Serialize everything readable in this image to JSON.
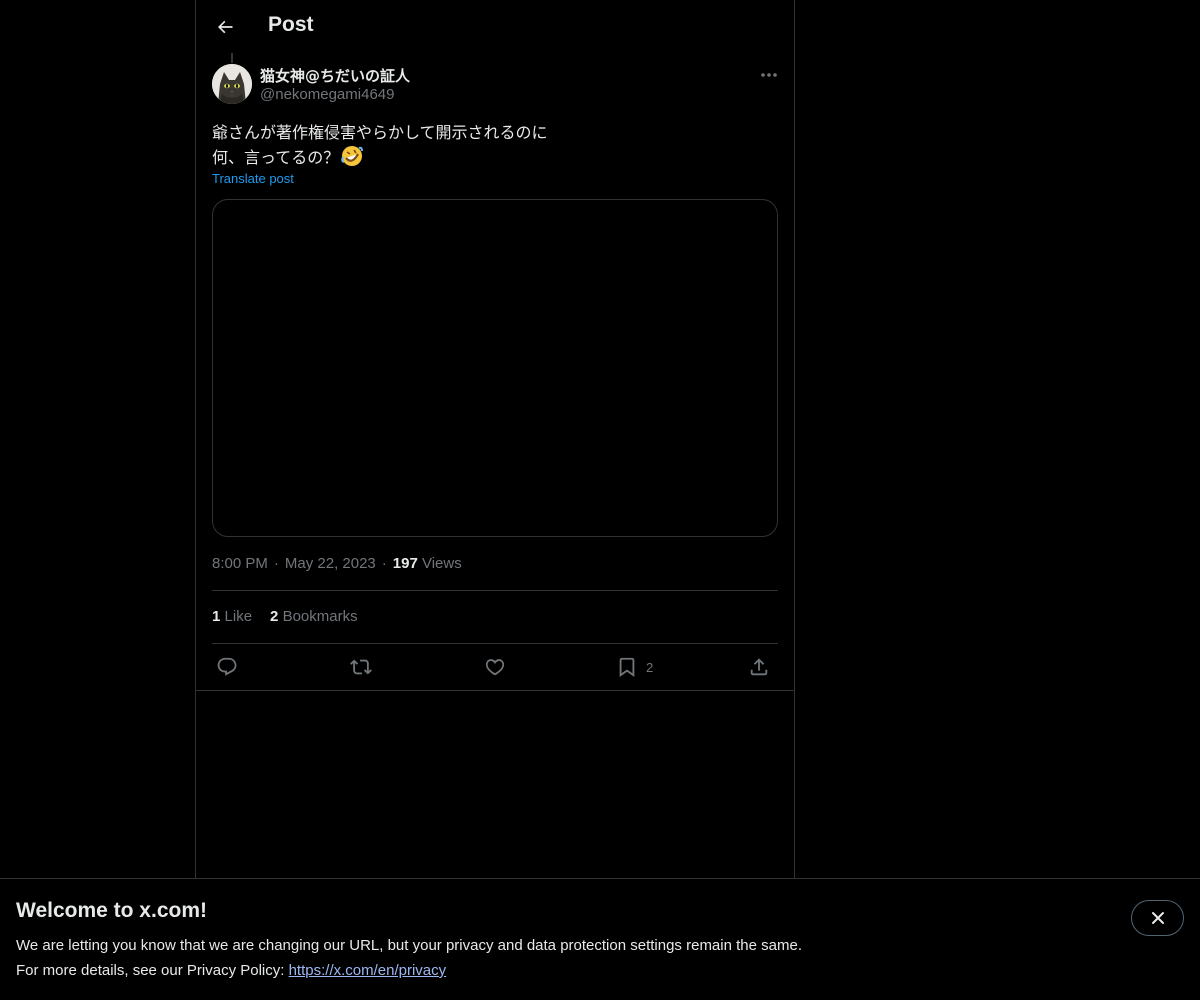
{
  "header": {
    "title": "Post",
    "back_icon": "arrow-left-icon"
  },
  "post": {
    "author": {
      "name": "猫女神@ちだいの証人",
      "handle": "@nekomegami4649",
      "avatar": "cat-avatar"
    },
    "text_lines": [
      "爺さんが著作権侵害やらかして開示されるのに",
      "何、言ってるの？"
    ],
    "emoji": "rolling-on-floor-laughing-emoji",
    "translate_label": "Translate post",
    "time": "8:00 PM",
    "separator": "·",
    "date": "May 22, 2023",
    "views_count": "197",
    "views_label": "Views",
    "likes_count": "1",
    "likes_label": "Like",
    "bookmarks_count": "2",
    "bookmarks_label": "Bookmarks",
    "actions": {
      "reply_icon": "reply-icon",
      "repost_icon": "repost-icon",
      "like_icon": "heart-icon",
      "bookmark_icon": "bookmark-icon",
      "bookmark_count": "2",
      "share_icon": "share-icon"
    }
  },
  "banner": {
    "title": "Welcome to x.com!",
    "line1": "We are letting you know that we are changing our URL, but your privacy and data protection settings remain the same.",
    "line2_prefix": "For more details, see our Privacy Policy: ",
    "link": "https://x.com/en/privacy",
    "close_icon": "close-icon"
  },
  "colors": {
    "background": "#000000",
    "text": "#e7e9ea",
    "muted": "#71767b",
    "accent": "#1d9bf0",
    "border": "#2f3336"
  }
}
